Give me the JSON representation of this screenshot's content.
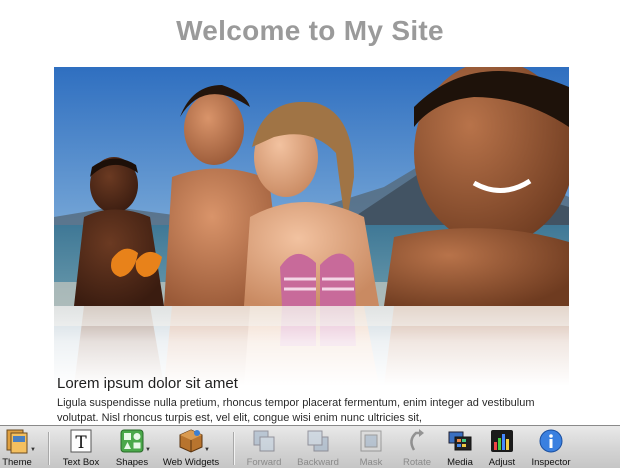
{
  "page": {
    "title": "Welcome to My Site",
    "heading": "Lorem ipsum dolor sit amet",
    "body": "Ligula suspendisse nulla pretium, rhoncus tempor placerat fermentum, enim integer ad vestibulum volutpat. Nisl rhoncus turpis est, vel elit, congue wisi enim nunc ultricies sit,"
  },
  "toolbar": {
    "items": [
      {
        "label": "Theme",
        "icon": "theme-icon",
        "enabled": true,
        "menu": true
      },
      {
        "label": "Text Box",
        "icon": "text-box-icon",
        "enabled": true,
        "menu": false
      },
      {
        "label": "Shapes",
        "icon": "shapes-icon",
        "enabled": true,
        "menu": true
      },
      {
        "label": "Web Widgets",
        "icon": "web-widgets-icon",
        "enabled": true,
        "menu": true
      },
      {
        "label": "Forward",
        "icon": "forward-icon",
        "enabled": false,
        "menu": false
      },
      {
        "label": "Backward",
        "icon": "backward-icon",
        "enabled": false,
        "menu": false
      },
      {
        "label": "Mask",
        "icon": "mask-icon",
        "enabled": false,
        "menu": false
      },
      {
        "label": "Rotate",
        "icon": "rotate-icon",
        "enabled": false,
        "menu": false
      },
      {
        "label": "Media",
        "icon": "media-icon",
        "enabled": true,
        "menu": false
      },
      {
        "label": "Adjust",
        "icon": "adjust-icon",
        "enabled": true,
        "menu": false
      },
      {
        "label": "Inspector",
        "icon": "inspector-icon",
        "enabled": true,
        "menu": false
      }
    ]
  },
  "colors": {
    "title": "#9a9a9a",
    "sky": "#4f88c6",
    "sea": "#3a6e8e",
    "toolbar": "#d4d4d4"
  }
}
